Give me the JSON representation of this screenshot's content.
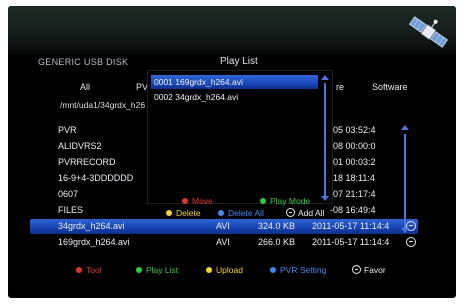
{
  "header": {
    "device_title": "GENERIC USB DISK",
    "playlist_title": "Play List"
  },
  "tabs": [
    {
      "label": "All"
    },
    {
      "label": "PVR"
    },
    {
      "label": "re"
    },
    {
      "label": "Software"
    }
  ],
  "mount_path": "/mnt/uda1/34grdx_h26",
  "files": [
    {
      "name": "PVR",
      "type": "",
      "size": "",
      "date": "-05 03:52:4",
      "selected": false
    },
    {
      "name": "ALIDVRS2",
      "type": "",
      "size": "",
      "date": "-08 00:00:0",
      "selected": false
    },
    {
      "name": "PVRRECORD",
      "type": "",
      "size": "",
      "date": "-01 00:03:2",
      "selected": false
    },
    {
      "name": "16-9+4-3DDDDDD",
      "type": "",
      "size": "",
      "date": "-18 18:11:4",
      "selected": false
    },
    {
      "name": "0607",
      "type": "",
      "size": "",
      "date": "-07 21:17:4",
      "selected": false
    },
    {
      "name": "FILES",
      "type": "",
      "size": "",
      "date": "-08 16:49:4",
      "selected": false
    },
    {
      "name": "34grdx_h264.avi",
      "type": "AVI",
      "size": "324.0 KB",
      "date": "2011-05-17 11:14:4",
      "selected": true
    },
    {
      "name": "169grdx_h264.avi",
      "type": "AVI",
      "size": "266.0 KB",
      "date": "2011-05-17 11:14:4",
      "selected": false
    }
  ],
  "playlist": {
    "items": [
      {
        "label": "0001  169grdx_h264.avi",
        "selected": true
      },
      {
        "label": "0002  34grdx_h264.avi",
        "selected": false
      }
    ],
    "actions": {
      "move": "Move",
      "play_mode": "Play Mode",
      "delete": "Delete",
      "delete_all": "Delete All",
      "add_all": "Add All"
    }
  },
  "bottom_bar": {
    "tool": "Tool",
    "play_list": "Play List",
    "upload": "Upload",
    "pvr_setting": "PVR Setting",
    "favor": "Favor"
  },
  "colors": {
    "red": "#e0372c",
    "green": "#2fcf3a",
    "yellow": "#f5d62c",
    "blue": "#3d8cf0",
    "highlight": "#1f4fc4"
  },
  "icons": {
    "satellite": "satellite-icon",
    "row_end": "circle-minus-icon"
  }
}
